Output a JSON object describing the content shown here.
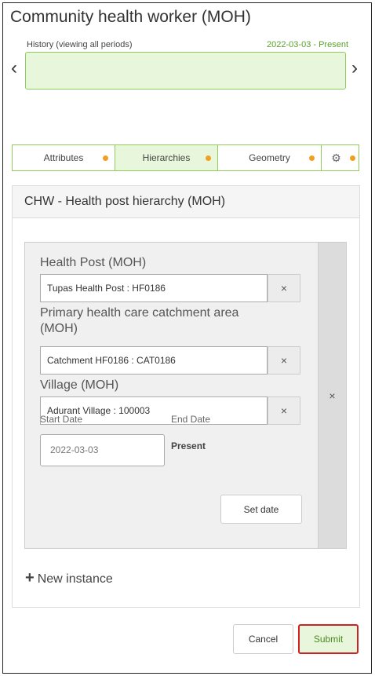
{
  "title": "Community health worker (MOH)",
  "history": {
    "label": "History  (viewing all periods)",
    "range": "2022-03-03 - Present",
    "prev_icon": "chevron-left-icon",
    "next_icon": "chevron-right-icon"
  },
  "tabs": [
    {
      "label": "Attributes",
      "dot": true
    },
    {
      "label": "Hierarchies",
      "dot": true,
      "active": true
    },
    {
      "label": "Geometry",
      "dot": true
    },
    {
      "label": "",
      "icon": "gear-icon",
      "dot": true
    }
  ],
  "panel": {
    "heading": "CHW - Health post hierarchy (MOH)",
    "fields": [
      {
        "label": "Health Post (MOH)",
        "value": "Tupas Health Post : HF0186"
      },
      {
        "label": "Primary health care catchment area (MOH)",
        "value": "Catchment HF0186 : CAT0186"
      },
      {
        "label": "Village (MOH)",
        "value": "Adurant Village : 100003"
      }
    ],
    "start_date_label": "Start Date",
    "end_date_label": "End Date",
    "start_date_value": "2022-03-03",
    "end_date_value": "Present",
    "set_date_label": "Set date",
    "clear_icon": "×",
    "new_instance_label": "New instance"
  },
  "buttons": {
    "cancel": "Cancel",
    "submit": "Submit"
  },
  "colors": {
    "accent_green": "#8fcc5d",
    "accent_green_bg": "#e8f6dc",
    "dot_orange": "#f0a020",
    "submit_border": "#cc2222"
  }
}
